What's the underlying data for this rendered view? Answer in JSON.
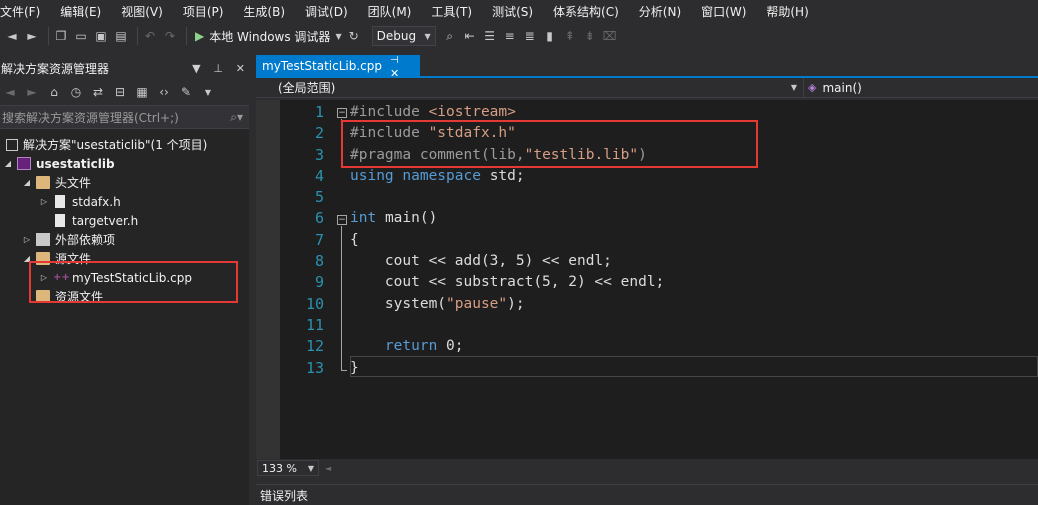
{
  "menu": [
    "文件(F)",
    "编辑(E)",
    "视图(V)",
    "项目(P)",
    "生成(B)",
    "调试(D)",
    "团队(M)",
    "工具(T)",
    "测试(S)",
    "体系结构(C)",
    "分析(N)",
    "窗口(W)",
    "帮助(H)"
  ],
  "toolbar": {
    "run_label": "本地 Windows 调试器",
    "config": "Debug"
  },
  "solution_explorer": {
    "title": "解决方案资源管理器",
    "search_placeholder": "搜索解决方案资源管理器(Ctrl+;)",
    "tree": {
      "solution": "解决方案\"usestaticlib\"(1 个项目)",
      "project": "usestaticlib",
      "header_folder": "头文件",
      "stdafx": "stdafx.h",
      "targetver": "targetver.h",
      "external": "外部依赖项",
      "source_folder": "源文件",
      "cpp_file": "myTestStaticLib.cpp",
      "resource_folder": "资源文件"
    }
  },
  "editor": {
    "tab_label": "myTestStaticLib.cpp",
    "scope": "(全局范围)",
    "member": "main()",
    "zoom": "133 %",
    "line_numbers": [
      "1",
      "2",
      "3",
      "4",
      "5",
      "6",
      "7",
      "8",
      "9",
      "10",
      "11",
      "12",
      "13"
    ],
    "code": {
      "l1_kw": "#include",
      "l1_inc": "<iostream>",
      "l2_kw": "#include",
      "l2_str": "\"stdafx.h\"",
      "l3_kw": "#pragma",
      "l3_rest": "comment(lib,",
      "l3_str": "\"testlib.lib\"",
      "l3_end": ")",
      "l4_using": "using",
      "l4_ns": "namespace",
      "l4_rest": "std;",
      "l6_int": "int",
      "l6_rest": "main()",
      "l7": "{",
      "l8": "cout << add(3, 5) << endl;",
      "l9": "cout << substract(5, 2) << endl;",
      "l10_fn": "system(",
      "l10_str": "\"pause\"",
      "l10_end": ");",
      "l12_kw": "return",
      "l12_rest": "0;",
      "l13": "}"
    }
  },
  "bottom_panel": {
    "label": "错误列表"
  },
  "colors": {
    "accent": "#007acc",
    "highlight_box": "#e53935"
  }
}
